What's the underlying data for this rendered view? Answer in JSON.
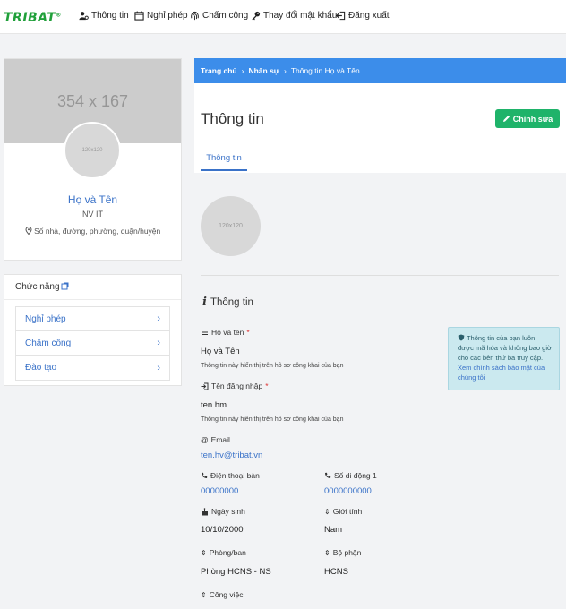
{
  "brand": {
    "logo_text": "TRIBAT",
    "logo_mark": "®"
  },
  "nav": {
    "items": [
      {
        "label": "Thông tin",
        "icon": "user-gear-icon"
      },
      {
        "label": "Nghỉ phép",
        "icon": "calendar-icon"
      },
      {
        "label": "Chấm công",
        "icon": "fingerprint-icon"
      },
      {
        "label": "Thay đổi mật khẩu",
        "icon": "key-icon"
      },
      {
        "label": "Đăng xuất",
        "icon": "logout-icon"
      }
    ]
  },
  "profile": {
    "cover_placeholder": "354 x 167",
    "avatar_placeholder": "120x120",
    "name": "Họ và Tên",
    "role": "NV IT",
    "address": "Số nhà, đường, phường, quận/huyện"
  },
  "functions": {
    "title": "Chức năng",
    "items": [
      "Nghỉ phép",
      "Chấm công",
      "Đào tạo"
    ]
  },
  "breadcrumb": {
    "home": "Trang chủ",
    "section": "Nhân sự",
    "current": "Thông tin Họ và Tên",
    "separator": "›"
  },
  "main": {
    "title": "Thông tin",
    "edit_label": "Chỉnh sửa",
    "tab_label": "Thông tin",
    "avatar_placeholder": "120x120",
    "section_title": "Thông tin"
  },
  "fields": {
    "full_name": {
      "label": "Họ và tên",
      "required": "*",
      "value": "Họ và Tên",
      "hint": "Thông tin này hiển thị trên hồ sơ công khai của bạn"
    },
    "username": {
      "label": "Tên đăng nhập",
      "required": "*",
      "value": "ten.hm",
      "hint": "Thông tin này hiển thị trên hồ sơ công khai của bạn"
    },
    "email": {
      "label": "Email",
      "value": "ten.hv@tribat.vn"
    },
    "desk_phone": {
      "label": "Điện thoại bàn",
      "value": "00000000"
    },
    "mobile": {
      "label": "Số di động 1",
      "value": "0000000000"
    },
    "birthday": {
      "label": "Ngày sinh",
      "value": "10/10/2000"
    },
    "gender": {
      "label": "Giới tính",
      "value": "Nam"
    },
    "room": {
      "label": "Phòng/ban",
      "value": "Phòng HCNS - NS"
    },
    "department": {
      "label": "Bộ phận",
      "value": "HCNS"
    },
    "job": {
      "label": "Công việc"
    }
  },
  "notice": {
    "text": "Thông tin của bạn luôn được mã hóa và không bao giờ cho các bên thứ ba truy cập.",
    "link": "Xem chính sách bảo mật của chúng tôi"
  },
  "colors": {
    "brand": "#20a03a",
    "accent": "#3c8dea",
    "link": "#3a72c8",
    "success": "#1fb36a",
    "notice_bg": "#cbe9ef"
  }
}
